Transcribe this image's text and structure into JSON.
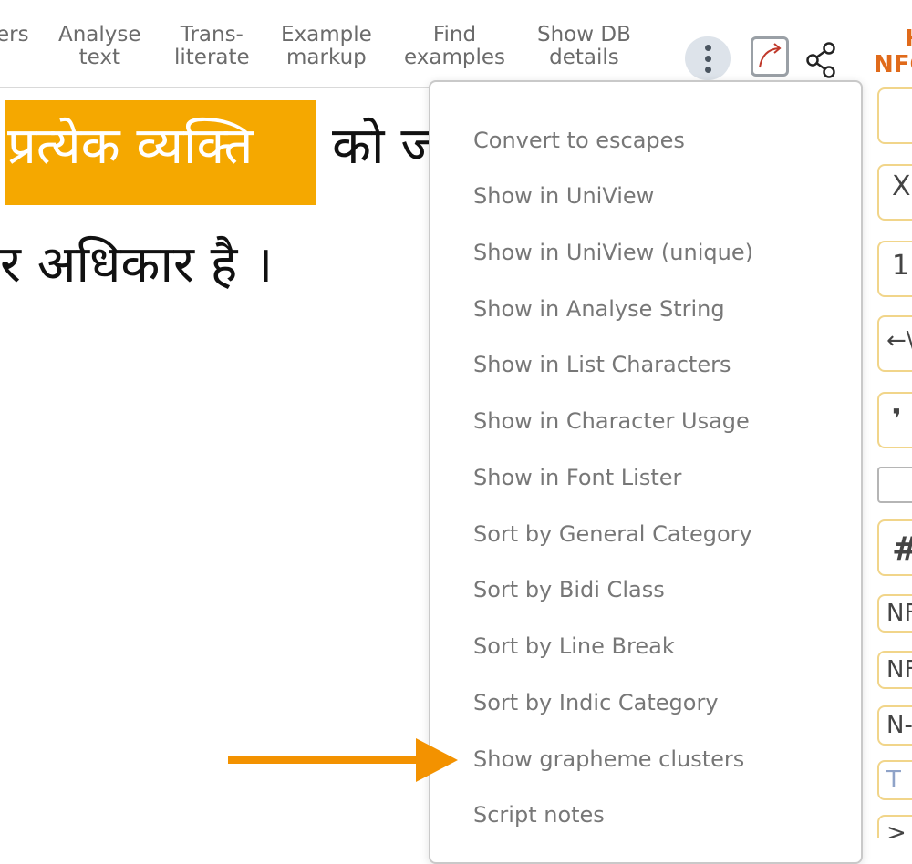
{
  "toolbar": {
    "items": [
      {
        "lines": [
          "",
          "ers"
        ]
      },
      {
        "lines": [
          "Analyse",
          "text"
        ]
      },
      {
        "lines": [
          "Trans-",
          "literate"
        ]
      },
      {
        "lines": [
          "Example",
          "markup"
        ]
      },
      {
        "lines": [
          "Find",
          "examples"
        ]
      },
      {
        "lines": [
          "Show DB",
          "details"
        ]
      }
    ],
    "right_label": [
      "H",
      "NFC"
    ]
  },
  "text": {
    "highlighted": "प्रत्येक व्यक्ति",
    "line1_rest": "को ज",
    "line2": "र अधिकार है ।"
  },
  "menu": {
    "items": [
      "Convert to escapes",
      "Show in UniView",
      "Show in UniView (unique)",
      "Show in Analyse String",
      "Show in List Characters",
      "Show in Character Usage",
      "Show in Font Lister",
      "Sort by General Category",
      "Sort by Bidi Class",
      "Sort by Line Break",
      "Sort by Indic Category",
      "Show grapheme clusters",
      "Script notes"
    ]
  },
  "side_panel": {
    "buttons": [
      "",
      "X",
      "1",
      "←\\",
      "❜",
      "",
      "#",
      "NF",
      "NF",
      "N-",
      "T",
      ">"
    ]
  },
  "colors": {
    "highlight": "#f5a800",
    "arrow": "#f39200",
    "accent_label": "#e06a1a"
  }
}
